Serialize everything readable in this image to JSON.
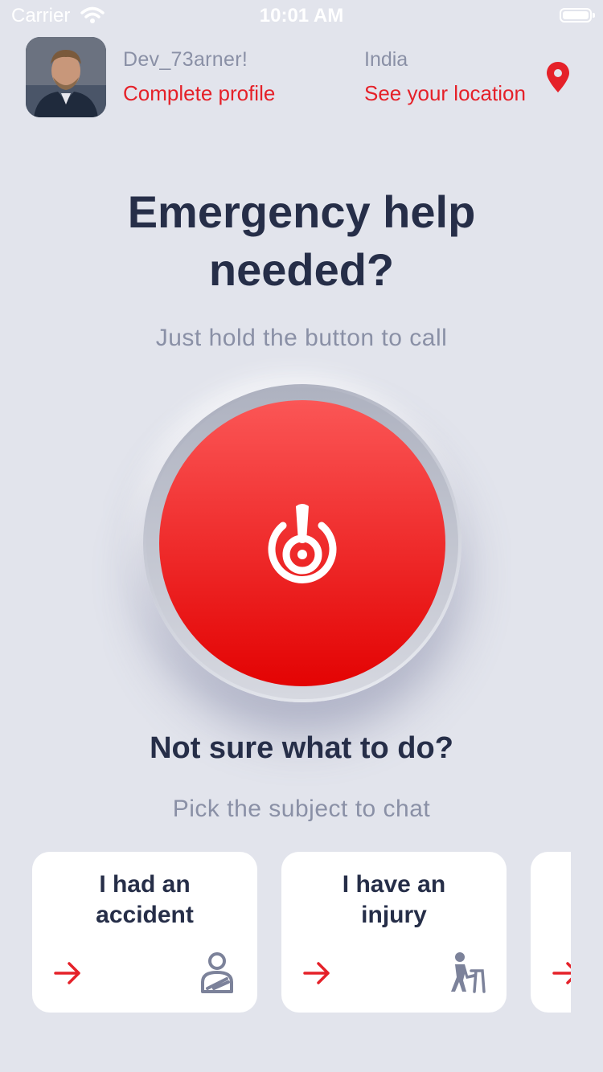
{
  "status_bar": {
    "carrier": "Carrier",
    "time": "10:01 AM"
  },
  "header": {
    "user_name": "Dev_73arner!",
    "profile_link": "Complete profile",
    "country": "India",
    "location_link": "See your location"
  },
  "main": {
    "headline": "Emergency help\nneeded?",
    "hint": "Just hold the button to call",
    "question": "Not sure what to do?",
    "pick": "Pick the subject to chat"
  },
  "cards": [
    {
      "title": "I had an\naccident",
      "icon": "injured-arm-icon"
    },
    {
      "title": "I have an\ninjury",
      "icon": "person-walker-icon"
    },
    {
      "title": "",
      "icon": "arrow-right-icon"
    }
  ],
  "colors": {
    "accent": "#e52129",
    "background": "#e2e4ec",
    "text": "#262e48",
    "muted": "#8a90a6"
  }
}
